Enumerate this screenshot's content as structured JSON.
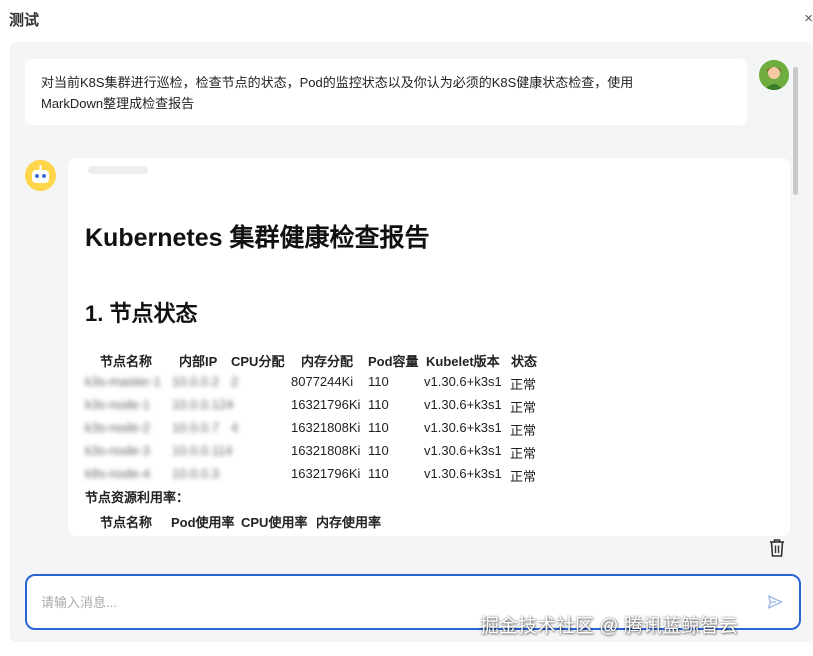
{
  "header": {
    "title": "测试",
    "close_icon": "×"
  },
  "user_message": {
    "text_line1": "对当前K8S集群进行巡检，检查节点的状态，Pod的监控状态以及你认为必须的K8S健康状态检查，使用",
    "text_line2": "MarkDown整理成检查报告"
  },
  "report": {
    "title": "Kubernetes 集群健康检查报告",
    "section1_title": "1. 节点状态",
    "node_table": {
      "columns": [
        "节点名称",
        "内部IP",
        "CPU分配",
        "内存分配",
        "Pod容量",
        "Kubelet版本",
        "状态"
      ],
      "rows": [
        {
          "name": "k3s-master-1",
          "ip": "10.0.0.2",
          "cpu": "2",
          "memory": "8077244Ki",
          "pods": "110",
          "kubelet": "v1.30.6+k3s1",
          "status": "正常"
        },
        {
          "name": "k3s-node-1",
          "ip": "10.0.0.124",
          "cpu": "",
          "memory": "16321796Ki",
          "pods": "110",
          "kubelet": "v1.30.6+k3s1",
          "status": "正常"
        },
        {
          "name": "k3s-node-2",
          "ip": "10.0.0.7",
          "cpu": "4",
          "memory": "16321808Ki",
          "pods": "110",
          "kubelet": "v1.30.6+k3s1",
          "status": "正常"
        },
        {
          "name": "k3s-node-3",
          "ip": "10.0.0.114",
          "cpu": "",
          "memory": "16321808Ki",
          "pods": "110",
          "kubelet": "v1.30.6+k3s1",
          "status": "正常"
        },
        {
          "name": "k8s-node-4",
          "ip": "10.0.0.3",
          "cpu": "",
          "memory": "16321796Ki",
          "pods": "110",
          "kubelet": "v1.30.6+k3s1",
          "status": "正常"
        }
      ]
    },
    "resource_label": "节点资源利用率：",
    "usage_table": {
      "columns": [
        "节点名称",
        "Pod使用率",
        "CPU使用率",
        "内存使用率"
      ]
    }
  },
  "input": {
    "placeholder": "请输入消息..."
  },
  "watermark": "掘金技术社区 @ 腾讯蓝鲸智云",
  "colors": {
    "accent": "#2a63d4",
    "chat_bg": "#f4f5f7",
    "bubble_bg": "#ffffff"
  },
  "icons": {
    "close": "close-icon",
    "trash": "trash-icon",
    "send": "send-icon"
  }
}
